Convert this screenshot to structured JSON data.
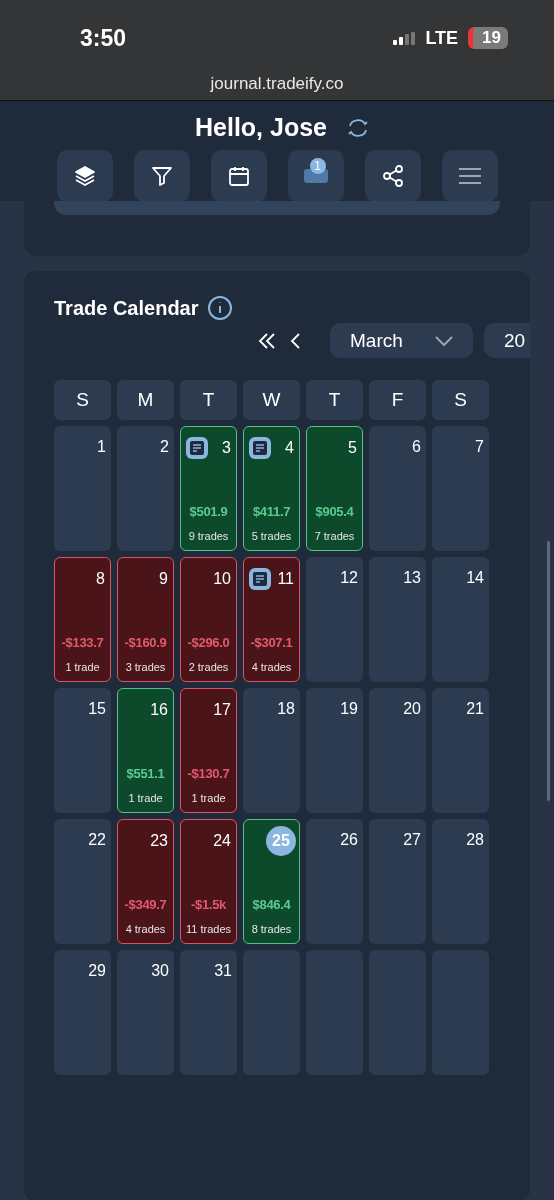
{
  "status_bar": {
    "time": "3:50",
    "network": "LTE",
    "battery": "19"
  },
  "address_bar": {
    "url": "journal.tradeify.co"
  },
  "header": {
    "greeting": "Hello, Jose",
    "toolbar": [
      {
        "kind": "layers"
      },
      {
        "kind": "filter"
      },
      {
        "kind": "calendar"
      },
      {
        "kind": "notifications",
        "badge": "1"
      },
      {
        "kind": "share"
      },
      {
        "kind": "menu"
      }
    ]
  },
  "calendar": {
    "title": "Trade Calendar",
    "month": "March",
    "year": "20",
    "weekdays": [
      "S",
      "M",
      "T",
      "W",
      "T",
      "F",
      "S"
    ],
    "days": [
      {
        "kind": "empty",
        "day": "1"
      },
      {
        "kind": "empty",
        "day": "2"
      },
      {
        "kind": "win",
        "day": "3",
        "amount": "$501.9",
        "trades": "9 trades",
        "note": true
      },
      {
        "kind": "win",
        "day": "4",
        "amount": "$411.7",
        "trades": "5 trades",
        "note": true
      },
      {
        "kind": "win",
        "day": "5",
        "amount": "$905.4",
        "trades": "7 trades"
      },
      {
        "kind": "empty",
        "day": "6"
      },
      {
        "kind": "empty",
        "day": "7"
      },
      {
        "kind": "loss",
        "day": "8",
        "amount": "-$133.7",
        "trades": "1 trade"
      },
      {
        "kind": "loss",
        "day": "9",
        "amount": "-$160.9",
        "trades": "3 trades"
      },
      {
        "kind": "loss",
        "day": "10",
        "amount": "-$296.0",
        "trades": "2 trades"
      },
      {
        "kind": "loss",
        "day": "11",
        "amount": "-$307.1",
        "trades": "4 trades",
        "note": true
      },
      {
        "kind": "empty",
        "day": "12"
      },
      {
        "kind": "empty",
        "day": "13"
      },
      {
        "kind": "empty",
        "day": "14"
      },
      {
        "kind": "empty",
        "day": "15"
      },
      {
        "kind": "win",
        "day": "16",
        "amount": "$551.1",
        "trades": "1 trade"
      },
      {
        "kind": "loss",
        "day": "17",
        "amount": "-$130.7",
        "trades": "1 trade"
      },
      {
        "kind": "empty",
        "day": "18"
      },
      {
        "kind": "empty",
        "day": "19"
      },
      {
        "kind": "empty",
        "day": "20"
      },
      {
        "kind": "empty",
        "day": "21"
      },
      {
        "kind": "empty",
        "day": "22"
      },
      {
        "kind": "loss",
        "day": "23",
        "amount": "-$349.7",
        "trades": "4 trades"
      },
      {
        "kind": "loss",
        "day": "24",
        "amount": "-$1.5k",
        "trades": "11 trades"
      },
      {
        "kind": "win",
        "day": "25",
        "amount": "$846.4",
        "trades": "8 trades",
        "today": true
      },
      {
        "kind": "empty",
        "day": "26"
      },
      {
        "kind": "empty",
        "day": "27"
      },
      {
        "kind": "empty",
        "day": "28"
      },
      {
        "kind": "empty",
        "day": "29"
      },
      {
        "kind": "empty",
        "day": "30"
      },
      {
        "kind": "empty",
        "day": "31"
      },
      {
        "kind": "blank"
      },
      {
        "kind": "blank"
      },
      {
        "kind": "blank"
      },
      {
        "kind": "blank"
      }
    ]
  }
}
